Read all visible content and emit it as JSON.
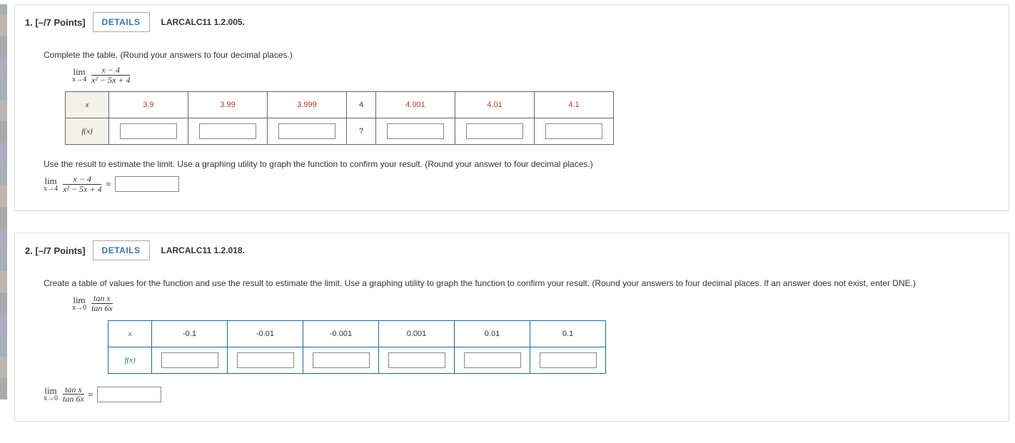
{
  "q1": {
    "number": "1.",
    "points": "[–/7 Points]",
    "details_label": "DETAILS",
    "ref": "LARCALC11 1.2.005.",
    "instr": "Complete the table. (Round your answers to four decimal places.)",
    "lim_top": "lim",
    "lim_bot": "x→4",
    "frac_num": "x − 4",
    "frac_den": "x² − 5x + 4",
    "row_x": "x",
    "row_fx": "f(x)",
    "xs": [
      "3.9",
      "3.99",
      "3.999",
      "4",
      "4.001",
      "4.01",
      "4.1"
    ],
    "mid": "?",
    "followup": "Use the result to estimate the limit. Use a graphing utility to graph the function to confirm your result. (Round your answer to four decimal places.)",
    "approx": "≈"
  },
  "q2": {
    "number": "2.",
    "points": "[–/7 Points]",
    "details_label": "DETAILS",
    "ref": "LARCALC11 1.2.018.",
    "instr": "Create a table of values for the function and use the result to estimate the limit. Use a graphing utility to graph the function to confirm your result. (Round your answers to four decimal places. If an answer does not exist, enter DNE.)",
    "lim_top": "lim",
    "lim_bot": "x→0",
    "frac_num": "tan x",
    "frac_den": "tan 6x",
    "row_x": "x",
    "row_fx": "f(x)",
    "xs": [
      "-0.1",
      "-0.01",
      "-0.001",
      "0.001",
      "0.01",
      "0.1"
    ],
    "approx": "≈"
  }
}
